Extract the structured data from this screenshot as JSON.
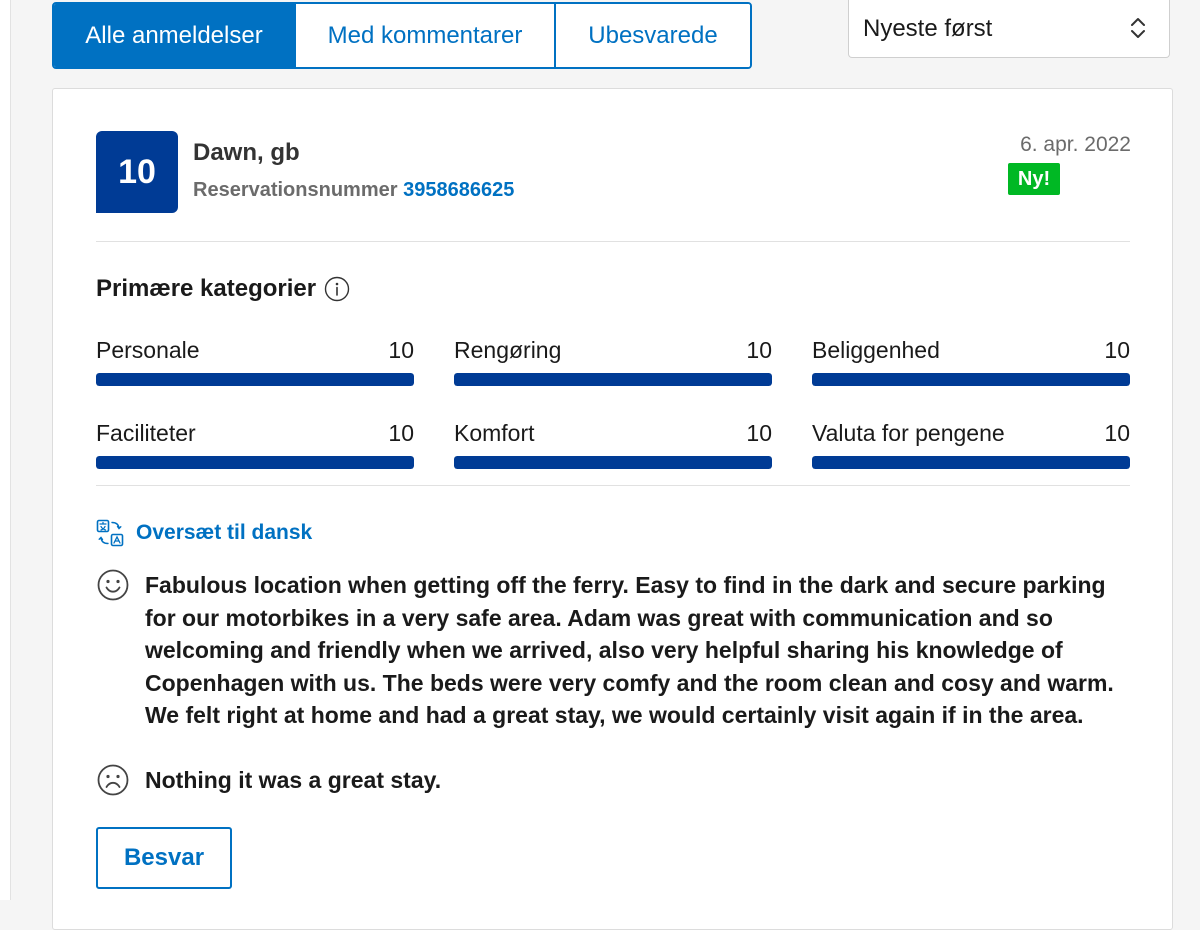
{
  "filters": {
    "tabs": [
      {
        "label": "Alle anmeldelser",
        "active": true
      },
      {
        "label": "Med kommentarer",
        "active": false
      },
      {
        "label": "Ubesvarede",
        "active": false
      }
    ]
  },
  "sort": {
    "selected": "Nyeste først",
    "icon": "chevron-up-down-icon"
  },
  "review": {
    "score": "10",
    "reviewer": "Dawn, gb",
    "reservation_label": "Reservationsnummer",
    "reservation_number": "3958686625",
    "date": "6. apr. 2022",
    "new_badge": "Ny!",
    "categories_heading": "Primære kategorier",
    "categories": [
      {
        "label": "Personale",
        "score": "10",
        "fill": 1.0
      },
      {
        "label": "Rengøring",
        "score": "10",
        "fill": 1.0
      },
      {
        "label": "Beliggenhed",
        "score": "10",
        "fill": 1.0
      },
      {
        "label": "Faciliteter",
        "score": "10",
        "fill": 1.0
      },
      {
        "label": "Komfort",
        "score": "10",
        "fill": 1.0
      },
      {
        "label": "Valuta for pengene",
        "score": "10",
        "fill": 1.0
      }
    ],
    "translate_label": "Oversæt til dansk",
    "positive_text": "Fabulous location when getting off the ferry. Easy to find in the dark and secure parking for our motorbikes in a very safe area. Adam was great with communication and so welcoming and friendly when we arrived, also very helpful sharing his knowledge of Copenhagen with us. The beds were very comfy and the room clean and cosy and warm. We felt right at home and had a great stay, we would certainly visit again if in the area.",
    "negative_text": "Nothing it was a great stay.",
    "reply_label": "Besvar"
  },
  "colors": {
    "primary": "#0071c2",
    "score_bg": "#003b95",
    "new_badge": "#00b824"
  }
}
